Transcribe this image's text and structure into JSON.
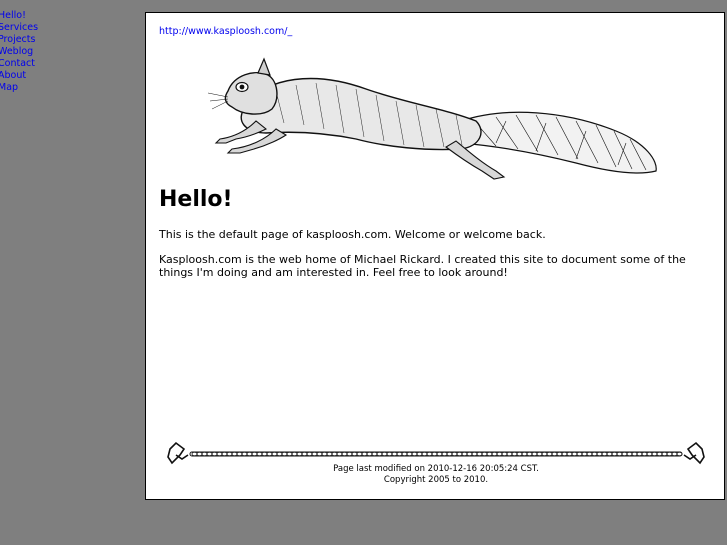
{
  "nav": {
    "items": [
      "Hello!",
      "Services",
      "Projects",
      "Weblog",
      "Contact",
      "About",
      "Map"
    ]
  },
  "header": {
    "url_link": "http://www.kasploosh.com/_"
  },
  "main": {
    "title": "Hello!",
    "paragraphs": [
      "This is the default page of kasploosh.com. Welcome or welcome back.",
      "Kasploosh.com is the web home of Michael Rickard. I created this site to document some of the things I'm doing and am interested in. Feel free to look around!"
    ]
  },
  "footer": {
    "modified": "Page last modified on 2010-12-16 20:05:24 CST.",
    "copyright": "Copyright 2005 to 2010."
  },
  "icons": {
    "squirrel": "flying-squirrel-illustration",
    "chain": "chain-divider"
  },
  "colors": {
    "background": "#7f7f7f",
    "link": "#0000ee",
    "card": "#ffffff"
  }
}
